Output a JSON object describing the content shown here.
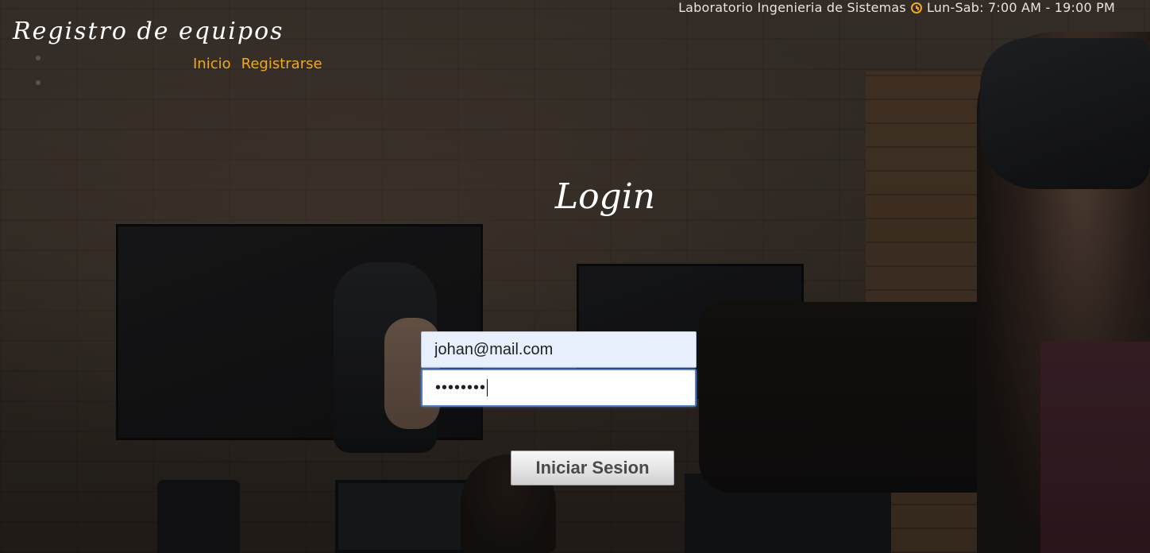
{
  "header": {
    "brand": "Registro de equipos",
    "lab_name": "Laboratorio Ingenieria de Sistemas",
    "schedule": "Lun-Sab: 7:00 AM - 19:00 PM",
    "clock_icon": "clock-icon"
  },
  "nav": {
    "items": [
      {
        "label": "Inicio"
      },
      {
        "label": "Registrarse"
      }
    ]
  },
  "login": {
    "title": "Login",
    "email_value": "johan@mail.com",
    "password_masked": "••••••••",
    "submit_label": "Iniciar Sesion"
  },
  "colors": {
    "accent": "#f0a821",
    "text_light": "#e9e4de",
    "autofill_bg": "#e8f0fe",
    "focus_border": "#4f7fc2"
  }
}
